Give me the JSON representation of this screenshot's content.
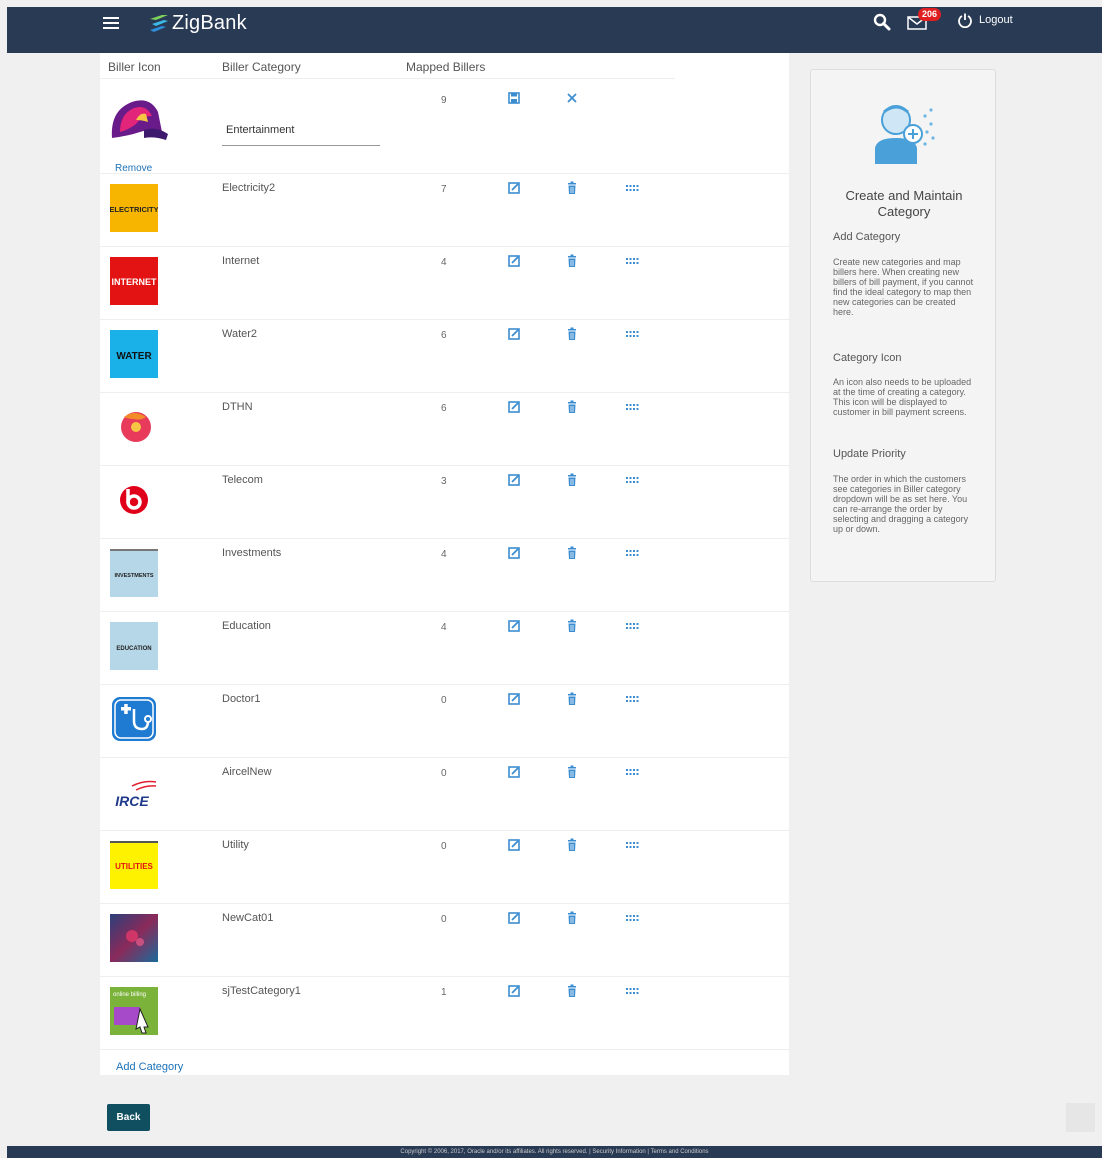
{
  "header": {
    "logo_text": "ZigBank",
    "mail_badge": "206",
    "logout_label": "Logout"
  },
  "table": {
    "headers": [
      "Biller Icon",
      "Biller Category",
      "Mapped Billers"
    ],
    "editing_row": {
      "category_value": "Entertainment",
      "count": "9",
      "remove_label": "Remove",
      "icon": "taco-bell-logo"
    },
    "rows": [
      {
        "name": "Electricity2",
        "count": "7",
        "icon_text": "ELECTRICITY",
        "icon": "electricity-logo"
      },
      {
        "name": "Internet",
        "count": "4",
        "icon_text": "INTERNET",
        "icon": "internet-logo"
      },
      {
        "name": "Water2",
        "count": "6",
        "icon_text": "WATER",
        "icon": "water-logo"
      },
      {
        "name": "DTHN",
        "count": "6",
        "icon_text": "",
        "icon": "dthn-logo"
      },
      {
        "name": "Telecom",
        "count": "3",
        "icon_text": "",
        "icon": "telecom-logo"
      },
      {
        "name": "Investments",
        "count": "4",
        "icon_text": "INVESTMENTS",
        "icon": "investments-logo"
      },
      {
        "name": "Education",
        "count": "4",
        "icon_text": "EDUCATION",
        "icon": "education-logo"
      },
      {
        "name": "Doctor1",
        "count": "0",
        "icon_text": "",
        "icon": "doctor-logo"
      },
      {
        "name": "AircelNew",
        "count": "0",
        "icon_text": "IRCE",
        "icon": "aircel-logo"
      },
      {
        "name": "Utility",
        "count": "0",
        "icon_text": "UTILITIES",
        "icon": "utilities-logo"
      },
      {
        "name": "NewCat01",
        "count": "0",
        "icon_text": "",
        "icon": "newcat-logo"
      },
      {
        "name": "sjTestCategory1",
        "count": "1",
        "icon_text": "online billing",
        "icon": "online-billing-logo"
      }
    ],
    "add_category_label": "Add Category"
  },
  "help": {
    "title": "Create and Maintain Category",
    "sections": [
      {
        "heading": "Add Category",
        "text": "Create new categories and map billers here. When creating new billers of bill payment, if you cannot find the ideal category to map then new categories can be created here."
      },
      {
        "heading": "Category Icon",
        "text": "An icon also needs to be uploaded at the time of creating a category. This icon will be displayed to customer in bill payment screens."
      },
      {
        "heading": "Update Priority",
        "text": "The order in which the customers see categories in Biller category dropdown will be as set here. You can re-arrange the order by selecting and dragging a category up or down."
      }
    ]
  },
  "back_label": "Back",
  "footer_text": "Copyright © 2006, 2017, Oracle and/or its affiliates. All rights reserved. | Security Information | Terms and Conditions",
  "colors": {
    "header_bg": "#283a54",
    "link": "#1d72b8",
    "back_button": "#0f4f5f",
    "badge": "#e02020"
  }
}
